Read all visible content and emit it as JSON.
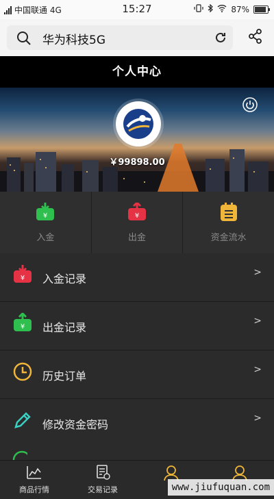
{
  "status_bar": {
    "carrier": "中国联通 4G",
    "time": "15:27",
    "battery_percent": 87,
    "battery_label": "87%"
  },
  "search": {
    "value": "华为科技5G"
  },
  "header": {
    "title": "个人中心"
  },
  "account": {
    "balance": "￥99898.00"
  },
  "quick_actions": [
    {
      "label": "入金",
      "icon": "deposit-icon",
      "color": "#2fbf4f"
    },
    {
      "label": "出金",
      "icon": "withdraw-icon",
      "color": "#e53245"
    },
    {
      "label": "资金流水",
      "icon": "ledger-icon",
      "color": "#f0b63a"
    }
  ],
  "menu": {
    "items": [
      {
        "label": "入金记录",
        "icon": "deposit-record-icon",
        "color": "#e53245"
      },
      {
        "label": "出金记录",
        "icon": "withdraw-record-icon",
        "color": "#2fbf4f"
      },
      {
        "label": "历史订单",
        "icon": "clock-icon",
        "color": "#f0b63a"
      },
      {
        "label": "修改资金密码",
        "icon": "pencil-icon",
        "color": "#3ad0c2"
      }
    ],
    "chevron": ">"
  },
  "tabbar": {
    "tabs": [
      {
        "label": "商品行情",
        "icon": "chart-icon"
      },
      {
        "label": "交易记录",
        "icon": "document-icon"
      },
      {
        "label": "",
        "icon": "user-icon",
        "color": "#f0b63a"
      },
      {
        "label": "",
        "icon": "user-icon",
        "color": "#f0b63a"
      }
    ]
  },
  "watermark": "www.jiufuquan.com"
}
